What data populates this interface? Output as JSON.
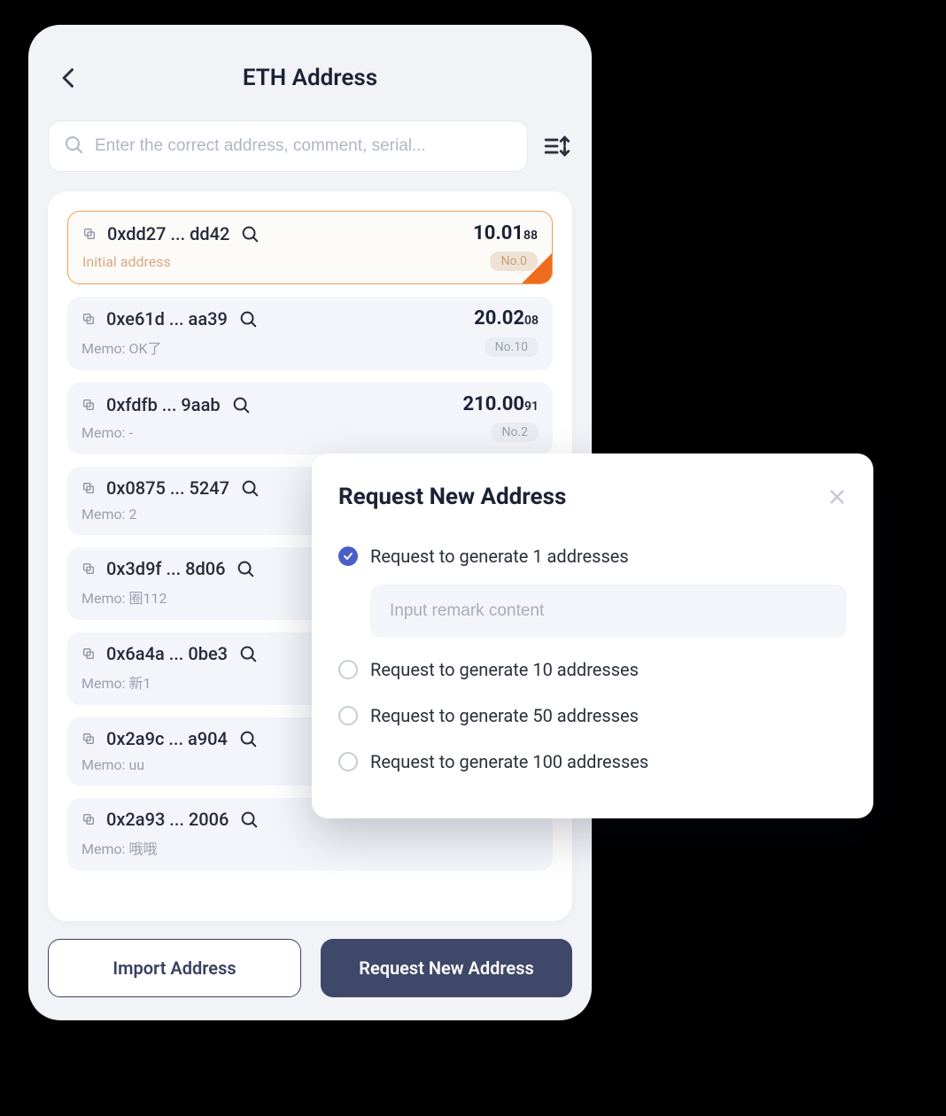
{
  "header": {
    "title": "ETH Address"
  },
  "search": {
    "placeholder": "Enter the correct address, comment, serial..."
  },
  "addresses": [
    {
      "addr": "0xdd27 ... dd42",
      "balance_int": "10.01",
      "balance_dec": "88",
      "memo": "Initial address",
      "no": "No.0",
      "current": true
    },
    {
      "addr": "0xe61d ... aa39",
      "balance_int": "20.02",
      "balance_dec": "08",
      "memo": "Memo: OK了",
      "no": "No.10",
      "current": false
    },
    {
      "addr": "0xfdfb ... 9aab",
      "balance_int": "210.00",
      "balance_dec": "91",
      "memo": "Memo: -",
      "no": "No.2",
      "current": false
    },
    {
      "addr": "0x0875 ... 5247",
      "balance_int": "",
      "balance_dec": "",
      "memo": "Memo: 2",
      "no": "",
      "current": false
    },
    {
      "addr": "0x3d9f ... 8d06",
      "balance_int": "",
      "balance_dec": "",
      "memo": "Memo: 圈112",
      "no": "",
      "current": false
    },
    {
      "addr": "0x6a4a ... 0be3",
      "balance_int": "",
      "balance_dec": "",
      "memo": "Memo: 新1",
      "no": "",
      "current": false
    },
    {
      "addr": "0x2a9c ... a904",
      "balance_int": "",
      "balance_dec": "",
      "memo": "Memo: uu",
      "no": "",
      "current": false
    },
    {
      "addr": "0x2a93 ... 2006",
      "balance_int": "",
      "balance_dec": "",
      "memo": "Memo: 哦哦",
      "no": "",
      "current": false
    }
  ],
  "buttons": {
    "import": "Import Address",
    "request": "Request New Address"
  },
  "modal": {
    "title": "Request New Address",
    "remark_placeholder": "Input remark content",
    "options": [
      {
        "label": "Request to generate 1 addresses",
        "checked": true
      },
      {
        "label": "Request to generate 10 addresses",
        "checked": false
      },
      {
        "label": "Request to generate 50 addresses",
        "checked": false
      },
      {
        "label": "Request to generate 100 addresses",
        "checked": false
      }
    ]
  }
}
